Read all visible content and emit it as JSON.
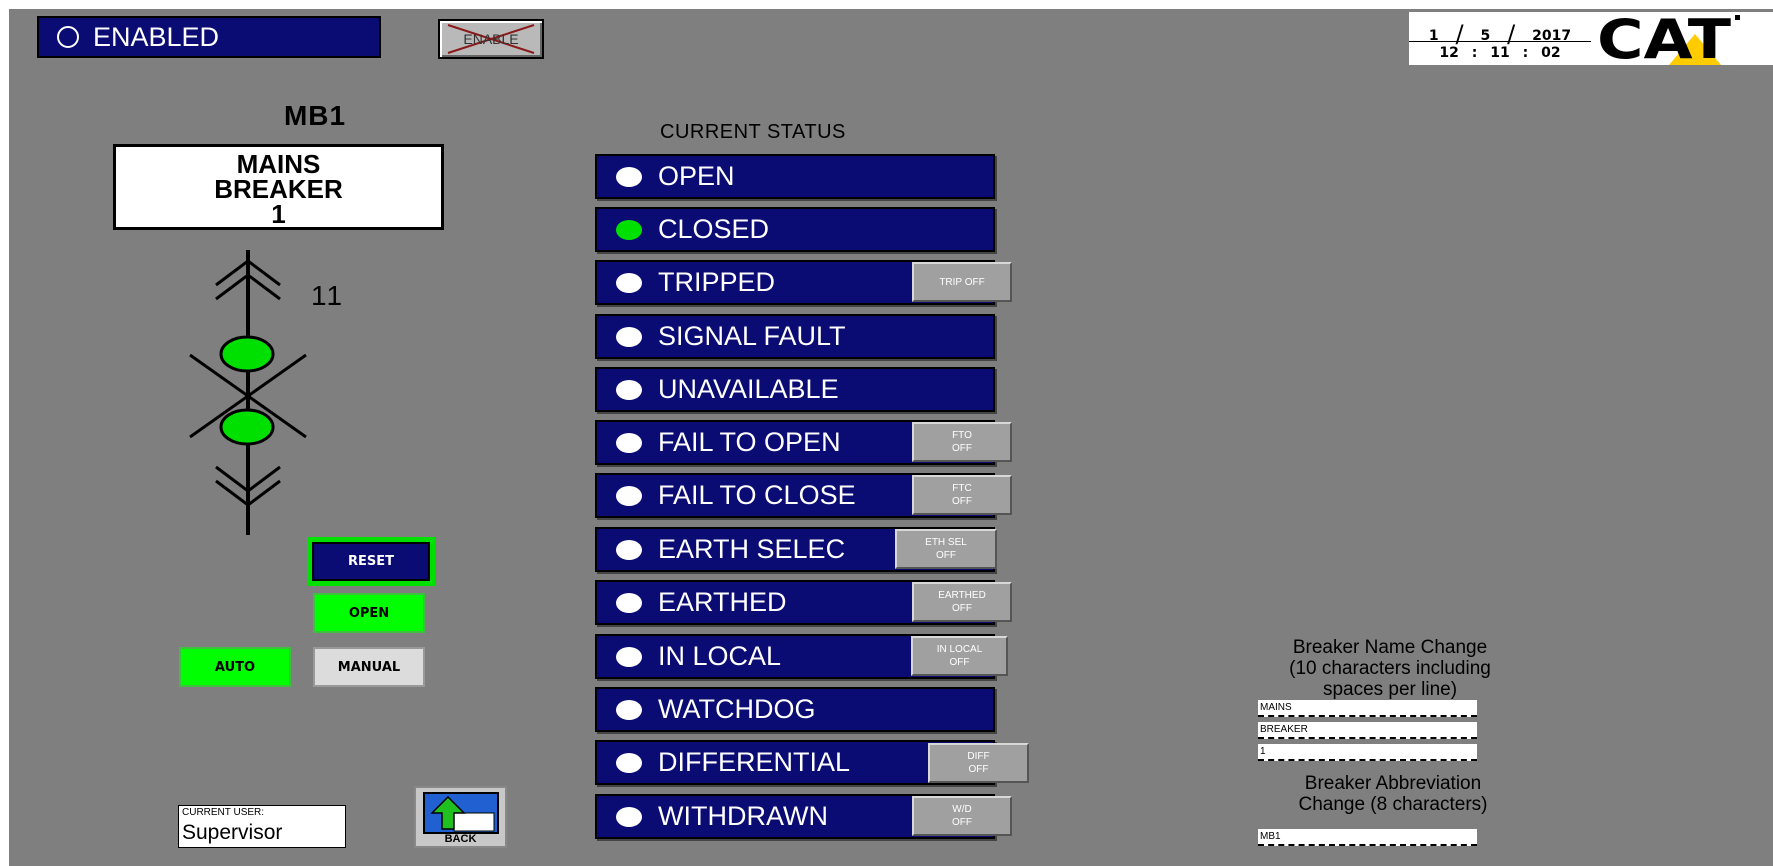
{
  "header": {
    "enabled_label": "ENABLED",
    "enable_button_label": "ENABLE",
    "date": {
      "month": "1",
      "day": "5",
      "year": "2017"
    },
    "time": {
      "hour": "12",
      "minute": "11",
      "second": "02"
    },
    "logo_text": "CAT"
  },
  "breaker": {
    "abbreviation": "MB1",
    "name_lines": [
      "MAINS",
      "BREAKER",
      "1"
    ],
    "number": "11",
    "indicator_color": "#00e000"
  },
  "controls": {
    "reset_label": "RESET",
    "open_label": "OPEN",
    "auto_label": "AUTO",
    "manual_label": "MANUAL"
  },
  "user": {
    "label": "CURRENT USER:",
    "value": "Supervisor"
  },
  "back_label": "BACK",
  "status": {
    "heading": "CURRENT STATUS",
    "items": [
      {
        "label": "OPEN",
        "active": false
      },
      {
        "label": "CLOSED",
        "active": true
      },
      {
        "label": "TRIPPED",
        "active": false,
        "button": "TRIP OFF"
      },
      {
        "label": "SIGNAL FAULT",
        "active": false
      },
      {
        "label": "UNAVAILABLE",
        "active": false
      },
      {
        "label": "FAIL TO OPEN",
        "active": false,
        "button_lines": [
          "FTO",
          "OFF"
        ]
      },
      {
        "label": "FAIL TO CLOSE",
        "active": false,
        "button_lines": [
          "FTC",
          "OFF"
        ]
      },
      {
        "label": "EARTH SELEC",
        "active": false,
        "button_lines": [
          "ETH SEL",
          "OFF"
        ]
      },
      {
        "label": "EARTHED",
        "active": false,
        "button_lines": [
          "EARTHED",
          "OFF"
        ]
      },
      {
        "label": "IN LOCAL",
        "active": false,
        "button_lines": [
          "IN LOCAL",
          "OFF"
        ]
      },
      {
        "label": "WATCHDOG",
        "active": false
      },
      {
        "label": "DIFFERENTIAL",
        "active": false,
        "button_lines": [
          "DIFF",
          "OFF"
        ]
      },
      {
        "label": "WITHDRAWN",
        "active": false,
        "button_lines": [
          "W/D",
          "OFF"
        ]
      }
    ],
    "active_color": "#00e000",
    "row_color": "#0b0b74"
  },
  "rename": {
    "name_heading_lines": [
      "Breaker Name Change",
      "(10 characters including",
      "spaces per line)"
    ],
    "name_fields": [
      "MAINS",
      "BREAKER",
      "1"
    ],
    "abbr_heading_lines": [
      "Breaker Abbreviation",
      "Change (8 characters)"
    ],
    "abbr_field": "MB1"
  },
  "colors": {
    "background": "#7f7f7f",
    "navy": "#0b0b74",
    "green": "#00ff00"
  }
}
